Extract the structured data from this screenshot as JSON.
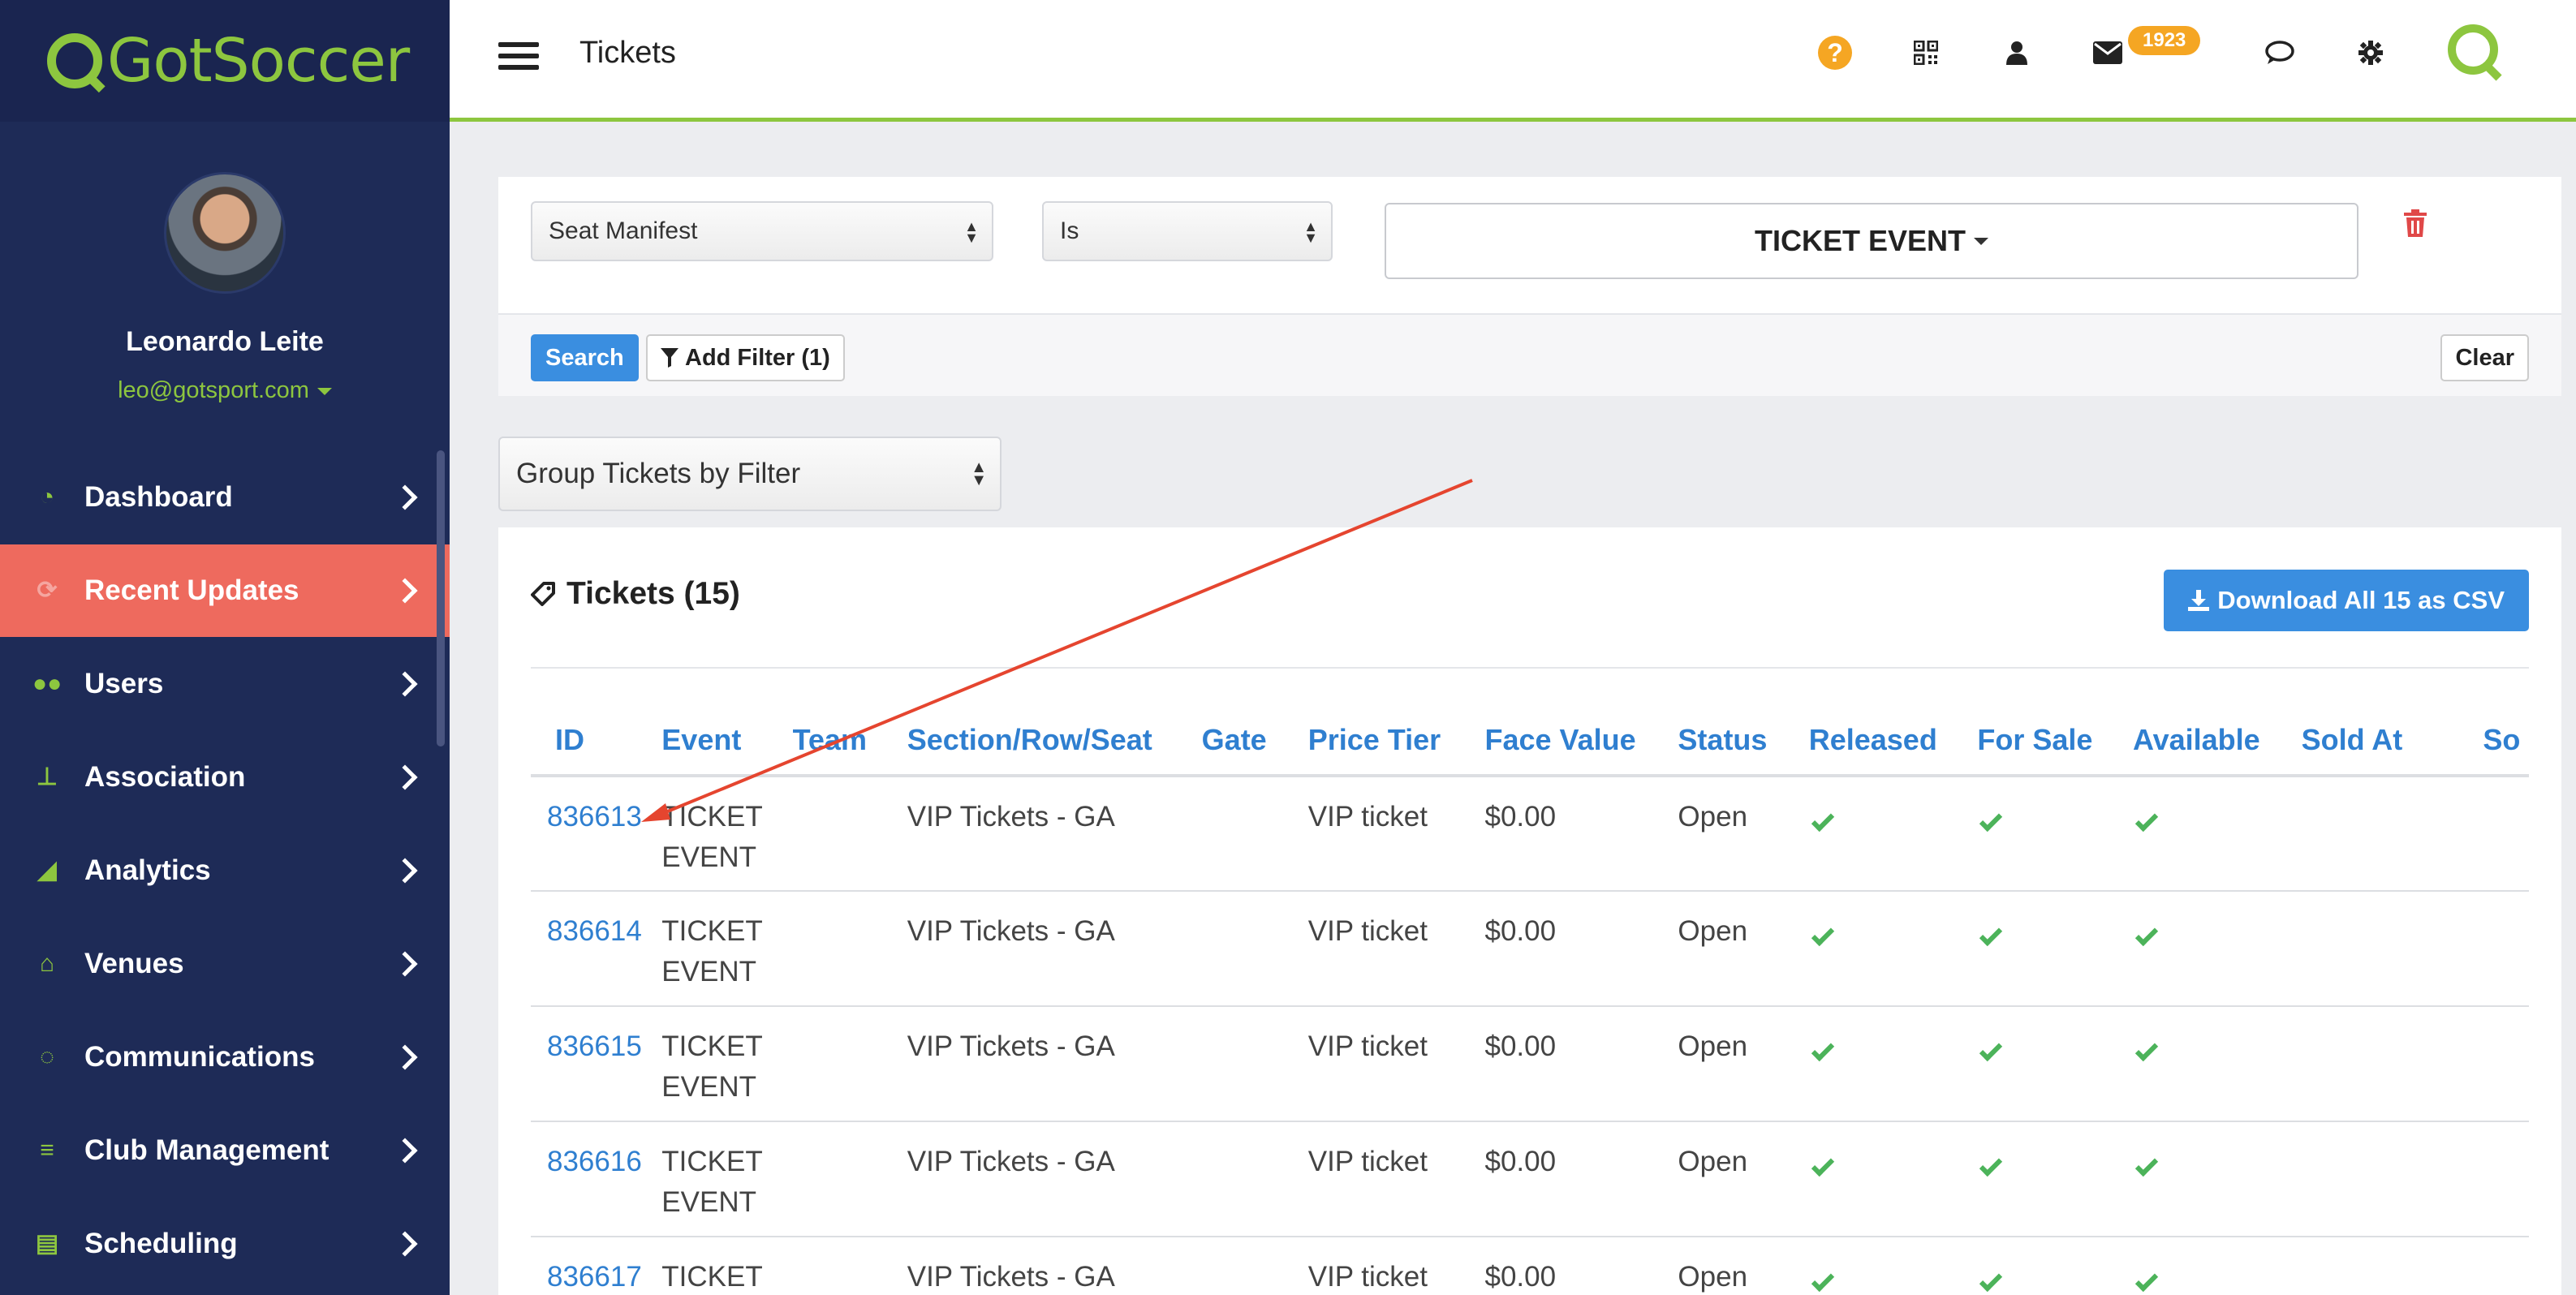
{
  "app": {
    "logo_text": "GotSoccer"
  },
  "profile": {
    "name": "Leonardo Leite",
    "email": "leo@gotsport.com"
  },
  "sidebar": {
    "items": [
      {
        "label": "Dashboard",
        "icon": "dashboard-icon",
        "active": false
      },
      {
        "label": "Recent Updates",
        "icon": "refresh-icon",
        "active": true
      },
      {
        "label": "Users",
        "icon": "users-icon",
        "active": false
      },
      {
        "label": "Association",
        "icon": "sitemap-icon",
        "active": false
      },
      {
        "label": "Analytics",
        "icon": "area-chart-icon",
        "active": false
      },
      {
        "label": "Venues",
        "icon": "home-icon",
        "active": false
      },
      {
        "label": "Communications",
        "icon": "comments-icon",
        "active": false
      },
      {
        "label": "Club Management",
        "icon": "list-icon",
        "active": false
      },
      {
        "label": "Scheduling",
        "icon": "calendar-list-icon",
        "active": false
      }
    ]
  },
  "topbar": {
    "title": "Tickets",
    "mail_count": "1923",
    "icons": [
      "question-icon",
      "qrcode-icon",
      "user-icon",
      "envelope-icon",
      "comment-icon",
      "gear-icon"
    ]
  },
  "filter": {
    "field": "Seat Manifest",
    "operator": "Is",
    "value": "TICKET EVENT",
    "search_label": "Search",
    "add_filter_label": "Add Filter (1)",
    "clear_label": "Clear"
  },
  "group": {
    "selected": "Group Tickets by Filter"
  },
  "tickets": {
    "title": "Tickets (15)",
    "download_label": "Download All 15 as CSV",
    "columns": [
      "ID",
      "Event",
      "Team",
      "Section/Row/Seat",
      "Gate",
      "Price Tier",
      "Face Value",
      "Status",
      "Released",
      "For Sale",
      "Available",
      "Sold At",
      "So"
    ],
    "rows": [
      {
        "id": "836613",
        "event": "TICKET EVENT",
        "team": "",
        "section": "VIP Tickets - GA",
        "gate": "",
        "price_tier": "VIP ticket",
        "face_value": "$0.00",
        "status": "Open",
        "released": true,
        "for_sale": true,
        "available": true,
        "sold_at": ""
      },
      {
        "id": "836614",
        "event": "TICKET EVENT",
        "team": "",
        "section": "VIP Tickets - GA",
        "gate": "",
        "price_tier": "VIP ticket",
        "face_value": "$0.00",
        "status": "Open",
        "released": true,
        "for_sale": true,
        "available": true,
        "sold_at": ""
      },
      {
        "id": "836615",
        "event": "TICKET EVENT",
        "team": "",
        "section": "VIP Tickets - GA",
        "gate": "",
        "price_tier": "VIP ticket",
        "face_value": "$0.00",
        "status": "Open",
        "released": true,
        "for_sale": true,
        "available": true,
        "sold_at": ""
      },
      {
        "id": "836616",
        "event": "TICKET EVENT",
        "team": "",
        "section": "VIP Tickets - GA",
        "gate": "",
        "price_tier": "VIP ticket",
        "face_value": "$0.00",
        "status": "Open",
        "released": true,
        "for_sale": true,
        "available": true,
        "sold_at": ""
      },
      {
        "id": "836617",
        "event": "TICKET",
        "team": "",
        "section": "VIP Tickets - GA",
        "gate": "",
        "price_tier": "VIP ticket",
        "face_value": "$0.00",
        "status": "Open",
        "released": true,
        "for_sale": true,
        "available": true,
        "sold_at": ""
      }
    ]
  },
  "colors": {
    "brand_green": "#8dc63f",
    "sidebar_bg": "#1e2b57",
    "active_item": "#ee6a5e",
    "link_blue": "#2f7fd0",
    "annotation_arrow": "#e5452f"
  }
}
